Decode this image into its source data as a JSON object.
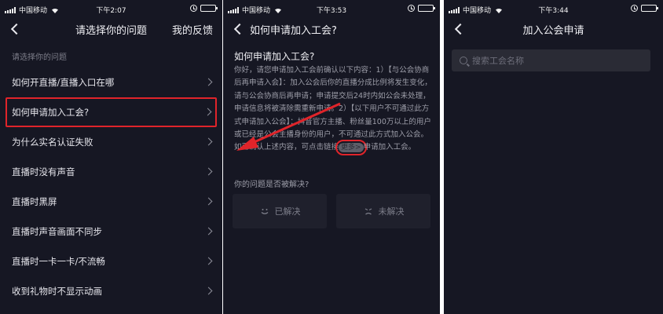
{
  "screens": [
    {
      "status": {
        "carrier": "中国移动",
        "time": "下午2:07",
        "battery": "",
        "battery_level": 0.9
      },
      "nav": {
        "title": "请选择你的问题",
        "action": "我的反馈"
      },
      "section_label": "请选择你的问题",
      "items": [
        {
          "label": "如何开直播/直播入口在哪"
        },
        {
          "label": "如何申请加入工会?"
        },
        {
          "label": "为什么实名认证失败"
        },
        {
          "label": "直播时没有声音"
        },
        {
          "label": "直播时黑屏"
        },
        {
          "label": "直播时声音画面不同步"
        },
        {
          "label": "直播时一卡一卡/不流畅"
        },
        {
          "label": "收到礼物时不显示动画"
        }
      ],
      "highlighted_index": 1
    },
    {
      "status": {
        "carrier": "中国移动",
        "time": "下午3:53",
        "battery": "",
        "battery_level": 0.85
      },
      "nav": {
        "title": "如何申请加入工会?"
      },
      "question_title": "如何申请加入工会?",
      "answer_text": "你好，请您申请加入工会前确认以下内容：1）【与公会协商后再申请入会】：加入公会后你的直播分成比例将发生变化，请与公会协商后再申请；申请提交后24时内如公会未处理，申请信息将被清除需重新申请。2）【以下用户不可通过此方式申请加入公会】：抖音官方主播、粉丝量100万以上的用户或已经是公会主播身份的用户，不可通过此方式加入公会。如已确认上述内容，可点击链接",
      "more_link": "更多>",
      "answer_tail": "申请加入工会。",
      "resolved_question": "你的问题是否被解决?",
      "vote_yes": "已解决",
      "vote_no": "未解决",
      "annotation_color": "#e0242a"
    },
    {
      "status": {
        "carrier": "中国移动",
        "time": "下午3:44",
        "battery": "",
        "battery_level": 0.85
      },
      "nav": {
        "title": "加入公会申请"
      },
      "search": {
        "placeholder": "搜索工会名称"
      }
    }
  ]
}
